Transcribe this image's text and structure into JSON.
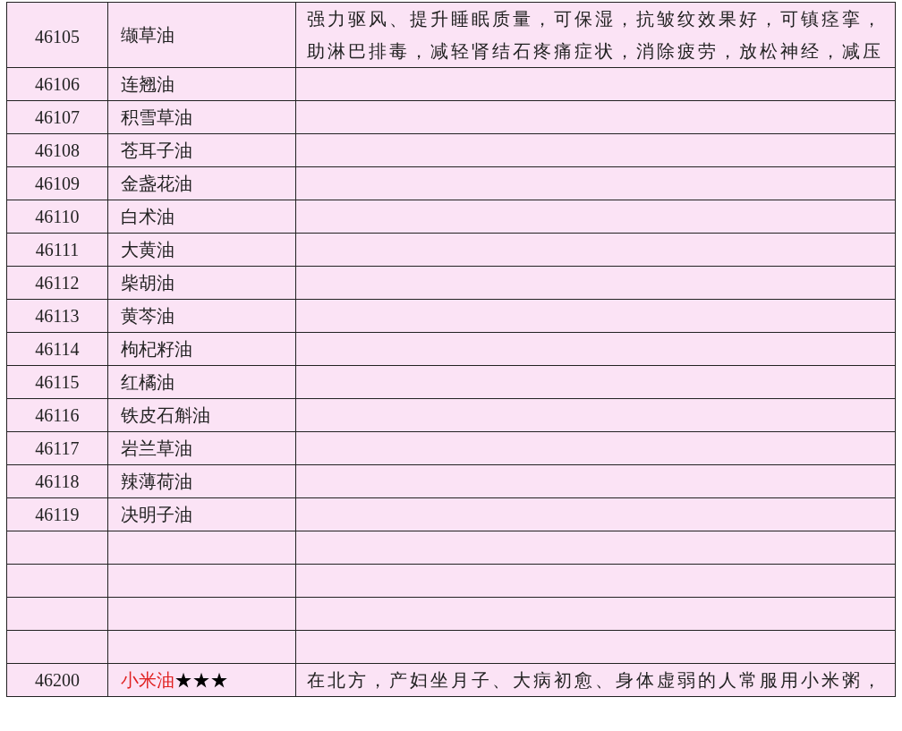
{
  "table": {
    "rows": [
      {
        "kind": "entry",
        "id": "46105",
        "name": "缬草油",
        "description": "强力驱风、提升睡眠质量，可保湿，抗皱纹效果好，可镇痉挛，助淋巴排毒，减轻肾结石疼痛症状，消除疲劳，放松神经，减压"
      },
      {
        "kind": "entry",
        "id": "46106",
        "name": "连翘油"
      },
      {
        "kind": "entry",
        "id": "46107",
        "name": "积雪草油"
      },
      {
        "kind": "entry",
        "id": "46108",
        "name": "苍耳子油"
      },
      {
        "kind": "entry",
        "id": "46109",
        "name": "金盏花油"
      },
      {
        "kind": "entry",
        "id": "46110",
        "name": "白术油"
      },
      {
        "kind": "entry",
        "id": "46111",
        "name": "大黄油"
      },
      {
        "kind": "entry",
        "id": "46112",
        "name": "柴胡油"
      },
      {
        "kind": "entry",
        "id": "46113",
        "name": "黄芩油"
      },
      {
        "kind": "entry",
        "id": "46114",
        "name": "枸杞籽油"
      },
      {
        "kind": "entry",
        "id": "46115",
        "name": "红橘油"
      },
      {
        "kind": "entry",
        "id": "46116",
        "name": "铁皮石斛油"
      },
      {
        "kind": "entry",
        "id": "46117",
        "name": "岩兰草油"
      },
      {
        "kind": "entry",
        "id": "46118",
        "name": "辣薄荷油"
      },
      {
        "kind": "entry",
        "id": "46119",
        "name": "决明子油"
      },
      {
        "kind": "blank"
      },
      {
        "kind": "blank"
      },
      {
        "kind": "blank"
      },
      {
        "kind": "blank"
      },
      {
        "kind": "entry",
        "id": "46200",
        "name": "小米油",
        "highlight": true,
        "stars": 3,
        "description": "在北方，产妇坐月子、大病初愈、身体虚弱的人常服用小米粥，"
      }
    ]
  }
}
